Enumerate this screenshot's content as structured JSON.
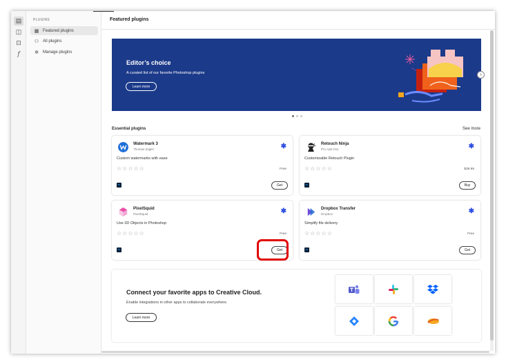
{
  "sidebar": {
    "heading": "PLUGINS",
    "items": [
      {
        "label": "Featured plugins",
        "icon": "featured-icon"
      },
      {
        "label": "All plugins",
        "icon": "binoculars-icon"
      },
      {
        "label": "Manage plugins",
        "icon": "gear-icon"
      }
    ]
  },
  "header": {
    "title": "Featured plugins"
  },
  "hero": {
    "title": "Editor’s choice",
    "subtitle": "A curated list of our favorite Photoshop plugins",
    "button_label": "Learn more",
    "next_glyph": "›"
  },
  "essential": {
    "title": "Essential plugins",
    "see_more": "See more",
    "plugins": [
      {
        "name": "Watermark 3",
        "developer": "Thomas Zagler",
        "description": "Custom watermarks with ease",
        "rating_stars": "☆☆☆☆☆",
        "price": "Free",
        "action": "Get",
        "app_badge": "Ps"
      },
      {
        "name": "Retouch Ninja",
        "developer": "Pro Add Ons",
        "description": "Customizable Retouch Plugin",
        "rating_stars": "☆☆☆☆☆",
        "price": "$39.95",
        "action": "Buy",
        "app_badge": "Ps"
      },
      {
        "name": "PixelSquid",
        "developer": "PixelSquid",
        "description": "Use 3D Objects in Photoshop",
        "rating_stars": "☆☆☆☆☆",
        "price": "Free",
        "action": "Get",
        "app_badge": "Ps"
      },
      {
        "name": "Dropbox Transfer",
        "developer": "Dropbox",
        "description": "Simplify file delivery",
        "rating_stars": "☆☆☆☆☆",
        "price": "Free",
        "action": "Get",
        "app_badge": "Ps"
      }
    ]
  },
  "connect": {
    "title": "Connect your favorite apps to Creative Cloud.",
    "subtitle": "Enable integrations in other apps to collaborate everywhere.",
    "button_label": "Learn more",
    "apps": [
      "teams-icon",
      "slack-icon",
      "dropbox-icon",
      "jira-icon",
      "google-icon",
      "wrike-icon"
    ]
  },
  "colors": {
    "hero_bg": "#1c3a8a",
    "accent": "#2b4de0",
    "highlight": "#e10000"
  }
}
